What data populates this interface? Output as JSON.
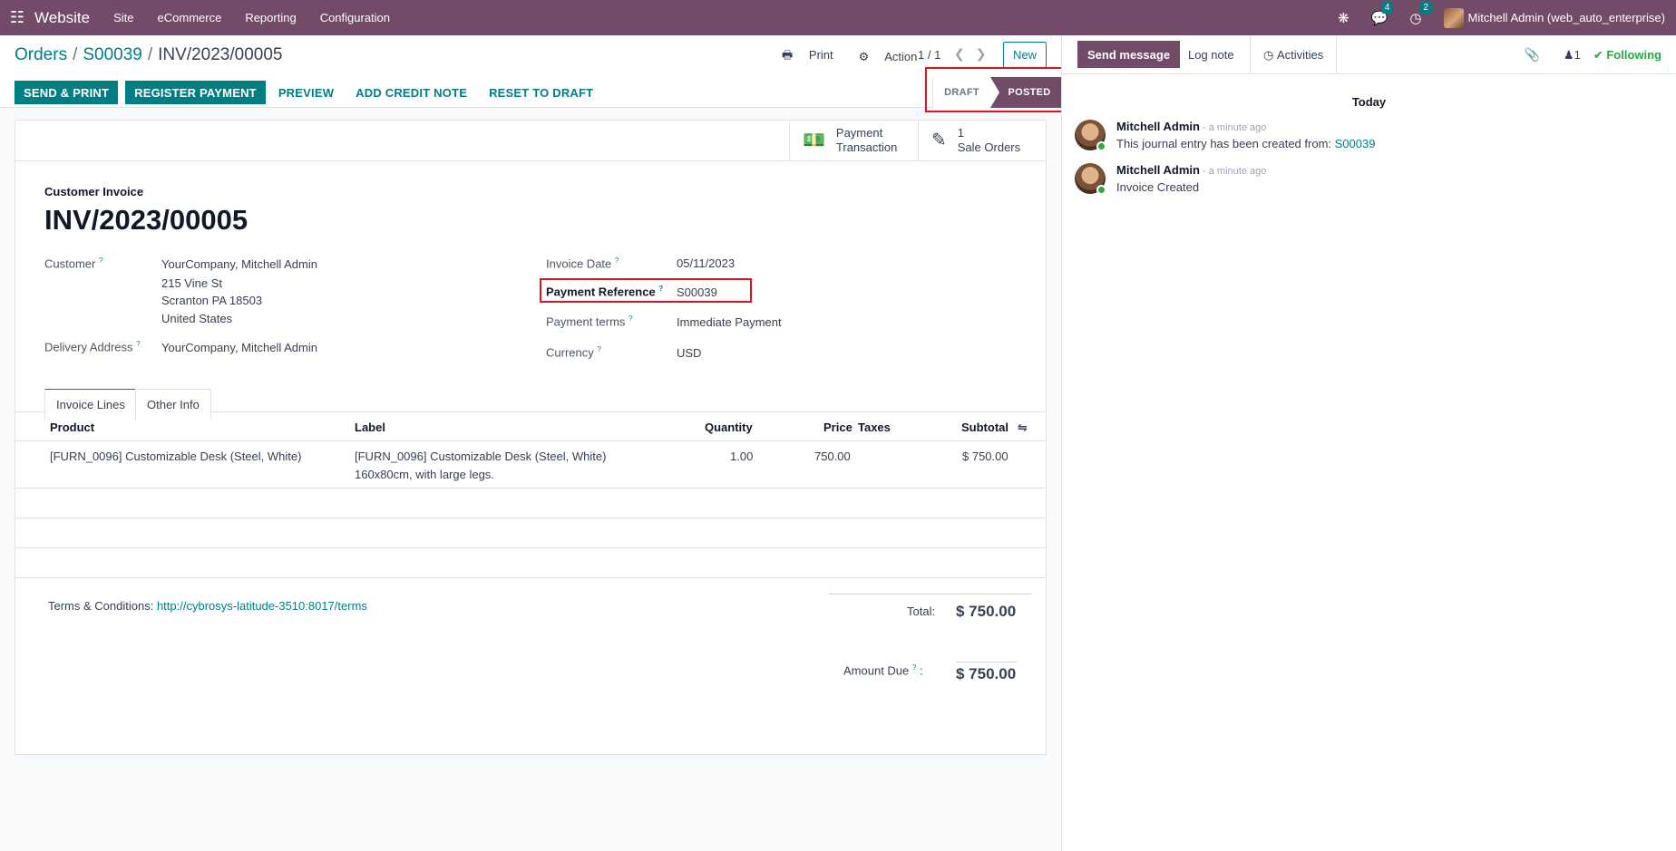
{
  "navbar": {
    "app_name": "Website",
    "menus": [
      "Site",
      "eCommerce",
      "Reporting",
      "Configuration"
    ],
    "messages_count": "4",
    "activities_count": "2",
    "user": "Mitchell Admin (web_auto_enterprise)"
  },
  "breadcrumb": {
    "root": "Orders",
    "parent": "S00039",
    "current": "INV/2023/00005"
  },
  "control": {
    "print_label": "Print",
    "action_label": "Action",
    "pager": "1 / 1",
    "new_label": "New"
  },
  "actions": {
    "send_print": "SEND & PRINT",
    "register_payment": "REGISTER PAYMENT",
    "preview": "PREVIEW",
    "add_credit_note": "ADD CREDIT NOTE",
    "reset_to_draft": "RESET TO DRAFT"
  },
  "status": {
    "draft": "DRAFT",
    "posted": "POSTED",
    "current": "POSTED"
  },
  "smart_buttons": {
    "payment_line1": "Payment",
    "payment_line2": "Transaction",
    "sale_count": "1",
    "sale_label": "Sale Orders"
  },
  "invoice": {
    "type_label": "Customer Invoice",
    "name": "INV/2023/00005",
    "customer_label": "Customer",
    "customer_name": "YourCompany, Mitchell Admin",
    "address_line1": "215 Vine St",
    "address_line2": "Scranton PA 18503",
    "address_line3": "United States",
    "delivery_label": "Delivery Address",
    "delivery_value": "YourCompany, Mitchell Admin",
    "invoice_date_label": "Invoice Date",
    "invoice_date": "05/11/2023",
    "payment_ref_label": "Payment Reference",
    "payment_ref": "S00039",
    "payment_terms_label": "Payment terms",
    "payment_terms": "Immediate Payment",
    "currency_label": "Currency",
    "currency": "USD"
  },
  "tabs": {
    "lines": "Invoice Lines",
    "other": "Other Info"
  },
  "table": {
    "columns": {
      "product": "Product",
      "label": "Label",
      "quantity": "Quantity",
      "price": "Price",
      "taxes": "Taxes",
      "subtotal": "Subtotal"
    },
    "rows": [
      {
        "product": "[FURN_0096] Customizable Desk (Steel, White)",
        "label_line1": "[FURN_0096] Customizable Desk (Steel, White)",
        "label_line2": "160x80cm, with large legs.",
        "quantity": "1.00",
        "price": "750.00",
        "taxes": "",
        "subtotal": "$ 750.00"
      }
    ]
  },
  "footer": {
    "terms_label": "Terms & Conditions:",
    "terms_link": "http://cybrosys-latitude-3510:8017/terms",
    "total_label": "Total:",
    "total_value": "$ 750.00",
    "amount_due_label": "Amount Due",
    "amount_due_value": "$ 750.00"
  },
  "chatter": {
    "send_message": "Send message",
    "log_note": "Log note",
    "activities": "Activities",
    "followers_count": "1",
    "following": "Following",
    "date_separator": "Today",
    "messages": [
      {
        "author": "Mitchell Admin",
        "time": " - a minute ago",
        "body": "This journal entry has been created from: ",
        "link": "S00039"
      },
      {
        "author": "Mitchell Admin",
        "time": " - a minute ago",
        "body": "Invoice Created",
        "link": ""
      }
    ]
  },
  "colors": {
    "brand": "#714b67",
    "accent": "#017e84",
    "highlight": "#e0121b"
  }
}
